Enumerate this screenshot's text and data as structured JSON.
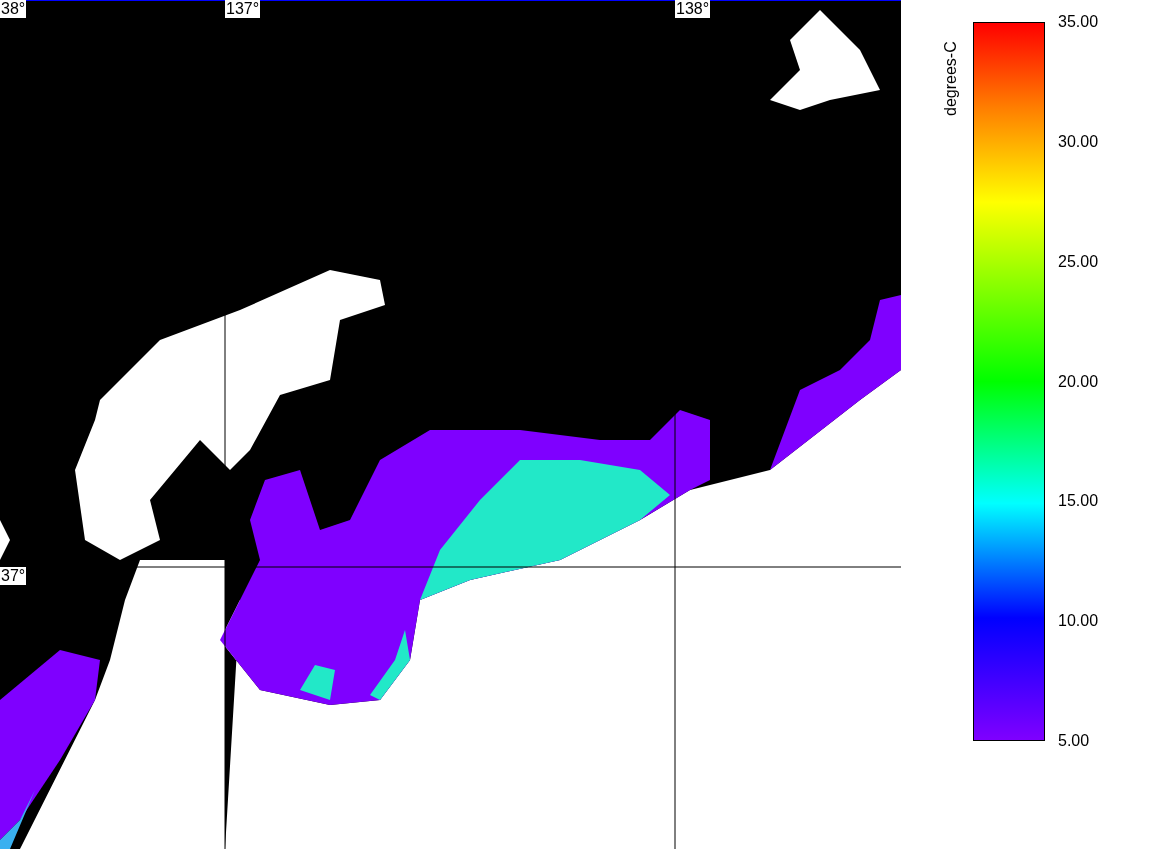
{
  "map": {
    "grid_labels": [
      "38°",
      "137°",
      "138°",
      "37°"
    ]
  },
  "colorbar": {
    "title": "degrees-C",
    "ticks": [
      "35.00",
      "30.00",
      "25.00",
      "20.00",
      "15.00",
      "10.00",
      "5.00"
    ]
  }
}
